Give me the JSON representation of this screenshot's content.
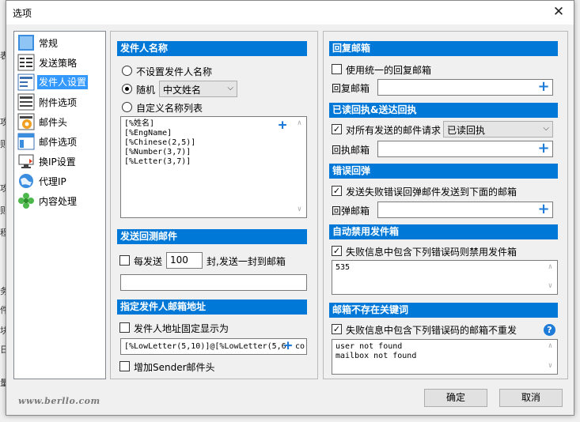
{
  "window": {
    "title": "选项",
    "close_glyph": "✕"
  },
  "backdrop_glyphs": [
    "表",
    "攻",
    "则",
    "攻",
    "则",
    "程",
    "务",
    "件",
    "块",
    "日",
    "量"
  ],
  "nav": {
    "items": [
      {
        "label": "常规",
        "icon": "general-icon"
      },
      {
        "label": "发送策略",
        "icon": "strategy-icon"
      },
      {
        "label": "发件人设置",
        "icon": "sender-icon",
        "selected": true
      },
      {
        "label": "附件选项",
        "icon": "attachment-icon"
      },
      {
        "label": "邮件头",
        "icon": "mail-header-icon"
      },
      {
        "label": "邮件选项",
        "icon": "mail-options-icon"
      },
      {
        "label": "换IP设置",
        "icon": "ip-switch-icon"
      },
      {
        "label": "代理IP",
        "icon": "proxy-globe-icon"
      },
      {
        "label": "内容处理",
        "icon": "content-puzzle-icon"
      }
    ]
  },
  "sender_name": {
    "header": "发件人名称",
    "opt_none": "不设置发件人名称",
    "opt_random": "随机",
    "random_select": "中文姓名",
    "opt_custom": "自定义名称列表",
    "list": [
      "[%姓名]",
      "[%EngName]",
      "[%Chinese(2,5)]",
      "[%Number(3,7)]",
      "[%Letter(3,7)]"
    ],
    "selected_option": "random"
  },
  "test_mail": {
    "header": "发送回测邮件",
    "every_label": "每发送",
    "count": "100",
    "suffix": "封,发送一封到邮箱",
    "checked": false,
    "address": ""
  },
  "sender_address": {
    "header": "指定发件人邮箱地址",
    "fixed_label": "发件人地址固定显示为",
    "fixed_checked": false,
    "pattern": "[%LowLetter(5,10)]@[%LowLetter(5,6",
    "pattern_tail": "co",
    "add_sender_label": "增加Sender邮件头",
    "add_sender_checked": false
  },
  "reply": {
    "header": "回复邮箱",
    "unify_label": "使用统一的回复邮箱",
    "unify_checked": false,
    "field_label": "回复邮箱",
    "value": ""
  },
  "read_receipt": {
    "header": "已读回执&送达回执",
    "request_label": "对所有发送的邮件请求",
    "request_checked": true,
    "select_value": "已读回执",
    "field_label": "回执邮箱",
    "value": ""
  },
  "bounce": {
    "header": "错误回弹",
    "forward_label": "发送失败错误回弹邮件发送到下面的邮箱",
    "forward_checked": true,
    "field_label": "回弹邮箱",
    "value": ""
  },
  "auto_disable": {
    "header": "自动禁用发件箱",
    "rule_label": "失败信息中包含下列错误码则禁用发件箱",
    "rule_checked": true,
    "codes": [
      "535"
    ]
  },
  "no_mailbox": {
    "header": "邮箱不存在关键词",
    "rule_label": "失败信息中包含下列错误码的邮箱不重发",
    "rule_checked": true,
    "keywords": [
      "user not found",
      "mailbox not found"
    ],
    "help_glyph": "?"
  },
  "buttons": {
    "ok": "确定",
    "cancel": "取消"
  },
  "watermark": "www.berllo.com",
  "glyphs": {
    "plus": "+",
    "check": "✓",
    "arrow": "⌵",
    "up": "∧",
    "down": "∨"
  },
  "colors": {
    "section_header": "#0078d7",
    "selection": "#3399ff",
    "plus": "#1e7bd8"
  }
}
